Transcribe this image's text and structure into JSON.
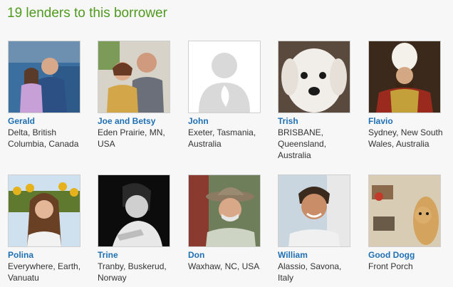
{
  "heading": "19 lenders to this borrower",
  "lenders": [
    {
      "name": "Gerald",
      "location": "Delta, British Columbia, Canada"
    },
    {
      "name": "Joe and Betsy",
      "location": "Eden Prairie, MN, USA"
    },
    {
      "name": "John",
      "location": "Exeter, Tasmania, Australia"
    },
    {
      "name": "Trish",
      "location": "BRISBANE, Queensland, Australia"
    },
    {
      "name": "Flavio",
      "location": "Sydney, New South Wales, Australia"
    },
    {
      "name": "Polina",
      "location": "Everywhere, Earth, Vanuatu"
    },
    {
      "name": "Trine",
      "location": "Tranby, Buskerud, Norway"
    },
    {
      "name": "Don",
      "location": "Waxhaw, NC, USA"
    },
    {
      "name": "William",
      "location": "Alassio, Savona, Italy"
    },
    {
      "name": "Good Dogg",
      "location": "Front Porch"
    }
  ],
  "colors": {
    "heading": "#4f9a1f",
    "link": "#1f6fb3"
  }
}
